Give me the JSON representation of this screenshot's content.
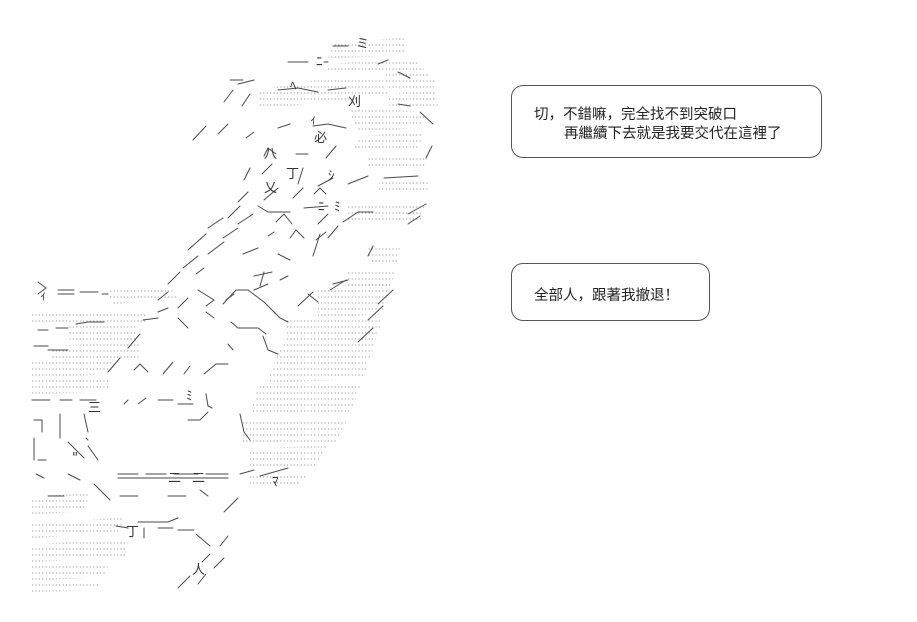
{
  "dialogue": {
    "bubble1": {
      "line1": "切，不錯嘛，完全找不到突破口",
      "line2": "再繼續下去就是我要交代在這裡了"
    },
    "bubble2": {
      "line1": "全部人，跟著我撤退！"
    }
  },
  "art": {
    "glyphs": {
      "f1": "ミ",
      "f2": "ﾍ",
      "f3": "ﾆ",
      "f4": "ｨ",
      "f5": "刈",
      "f6": "必",
      "f7": "八",
      "f8": "ﾐ",
      "f9": "ﾆ",
      "f10": "丁",
      "f11": "乂",
      "f12": "\"",
      "f13": "ｨ",
      "f14": "ﾐ",
      "f15": "ｼ",
      "f16": "三",
      "f17": "二",
      "f18": "二",
      "f19": "丁",
      "f20": "人",
      "f21": "ﾏ"
    }
  },
  "colors": {
    "ink": "#333333",
    "bubble_border": "#555555"
  }
}
